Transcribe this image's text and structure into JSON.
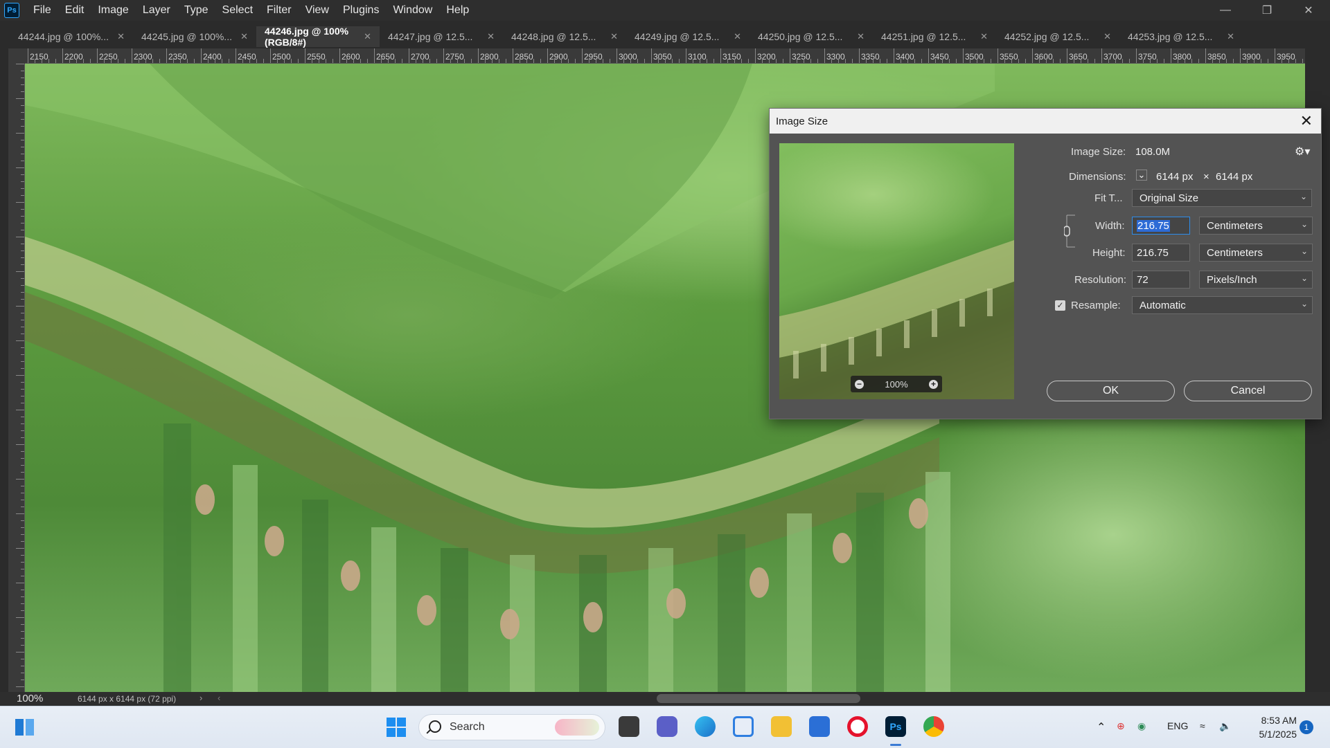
{
  "menu": [
    "File",
    "Edit",
    "Image",
    "Layer",
    "Type",
    "Select",
    "Filter",
    "View",
    "Plugins",
    "Window",
    "Help"
  ],
  "app_icon": "Ps",
  "tabs": [
    {
      "label": "44244.jpg @ 100%...",
      "active": false
    },
    {
      "label": "44245.jpg @ 100%...",
      "active": false
    },
    {
      "label": "44246.jpg @ 100% (RGB/8#)",
      "active": true
    },
    {
      "label": "44247.jpg @ 12.5...",
      "active": false
    },
    {
      "label": "44248.jpg @ 12.5...",
      "active": false
    },
    {
      "label": "44249.jpg @ 12.5...",
      "active": false
    },
    {
      "label": "44250.jpg @ 12.5...",
      "active": false
    },
    {
      "label": "44251.jpg @ 12.5...",
      "active": false
    },
    {
      "label": "44252.jpg @ 12.5...",
      "active": false
    },
    {
      "label": "44253.jpg @ 12.5...",
      "active": false
    }
  ],
  "ruler_labels": [
    "2150",
    "2200",
    "2250",
    "2300",
    "2350",
    "2400",
    "2450",
    "2500",
    "2550",
    "2600",
    "2650",
    "2700",
    "2750",
    "2800",
    "2850",
    "2900",
    "2950",
    "3000",
    "3050",
    "3100",
    "3150",
    "3200",
    "3250",
    "3300",
    "3350",
    "3400",
    "3450",
    "3500",
    "3550",
    "3600",
    "3650",
    "3700",
    "3750",
    "3800",
    "3850",
    "3900",
    "3950"
  ],
  "status": {
    "zoom": "100%",
    "info": "6144 px x 6144 px (72 ppi)"
  },
  "dialog": {
    "title": "Image Size",
    "preview_zoom": "100%",
    "image_size_label": "Image Size:",
    "image_size_value": "108.0M",
    "dimensions_label": "Dimensions:",
    "dim_w": "6144 px",
    "dim_x": "×",
    "dim_h": "6144 px",
    "fit_label": "Fit T...",
    "fit_value": "Original Size",
    "width_label": "Width:",
    "width_value": "216.75",
    "width_unit": "Centimeters",
    "height_label": "Height:",
    "height_value": "216.75",
    "height_unit": "Centimeters",
    "resolution_label": "Resolution:",
    "resolution_value": "72",
    "resolution_unit": "Pixels/Inch",
    "resample_label": "Resample:",
    "resample_checked": true,
    "resample_value": "Automatic",
    "ok": "OK",
    "cancel": "Cancel"
  },
  "taskbar": {
    "search": "Search",
    "lang": "ENG",
    "time": "8:53 AM",
    "date": "5/1/2025",
    "notifications": "1"
  }
}
